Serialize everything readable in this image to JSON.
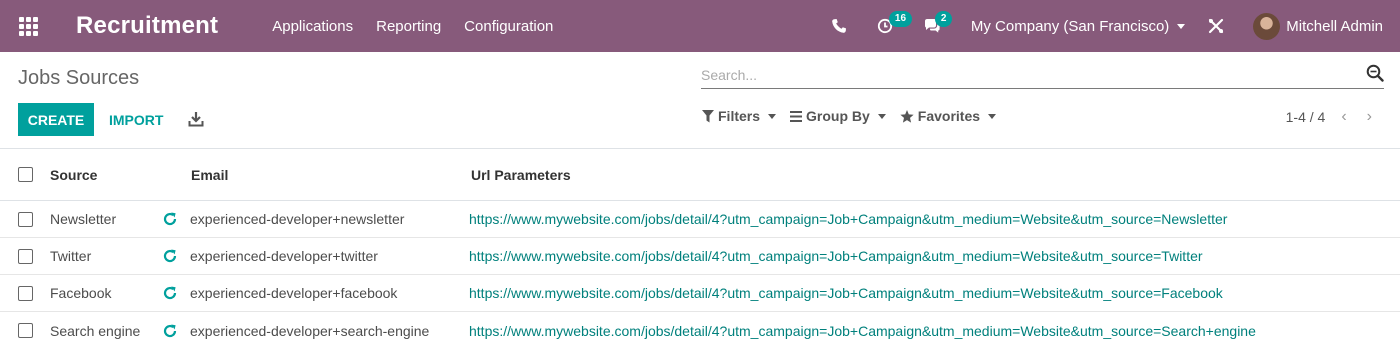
{
  "navbar": {
    "app_name": "Recruitment",
    "menu": [
      "Applications",
      "Reporting",
      "Configuration"
    ],
    "activity_count": "16",
    "message_count": "2",
    "company": "My Company (San Francisco)",
    "user": "Mitchell Admin"
  },
  "control_panel": {
    "title": "Jobs Sources",
    "search_placeholder": "Search...",
    "create_label": "CREATE",
    "import_label": "IMPORT",
    "filters_label": "Filters",
    "group_by_label": "Group By",
    "favorites_label": "Favorites",
    "pager": "1-4 / 4"
  },
  "table": {
    "headers": {
      "source": "Source",
      "email": "Email",
      "url": "Url Parameters"
    },
    "rows": [
      {
        "source": "Newsletter",
        "email": "experienced-developer+newsletter",
        "url": "https://www.mywebsite.com/jobs/detail/4?utm_campaign=Job+Campaign&utm_medium=Website&utm_source=Newsletter"
      },
      {
        "source": "Twitter",
        "email": "experienced-developer+twitter",
        "url": "https://www.mywebsite.com/jobs/detail/4?utm_campaign=Job+Campaign&utm_medium=Website&utm_source=Twitter"
      },
      {
        "source": "Facebook",
        "email": "experienced-developer+facebook",
        "url": "https://www.mywebsite.com/jobs/detail/4?utm_campaign=Job+Campaign&utm_medium=Website&utm_source=Facebook"
      },
      {
        "source": "Search engine",
        "email": "experienced-developer+search-engine",
        "url": "https://www.mywebsite.com/jobs/detail/4?utm_campaign=Job+Campaign&utm_medium=Website&utm_source=Search+engine"
      }
    ]
  },
  "colors": {
    "navbar": "#875a7b",
    "accent": "#00a09d",
    "link": "#00807c"
  }
}
